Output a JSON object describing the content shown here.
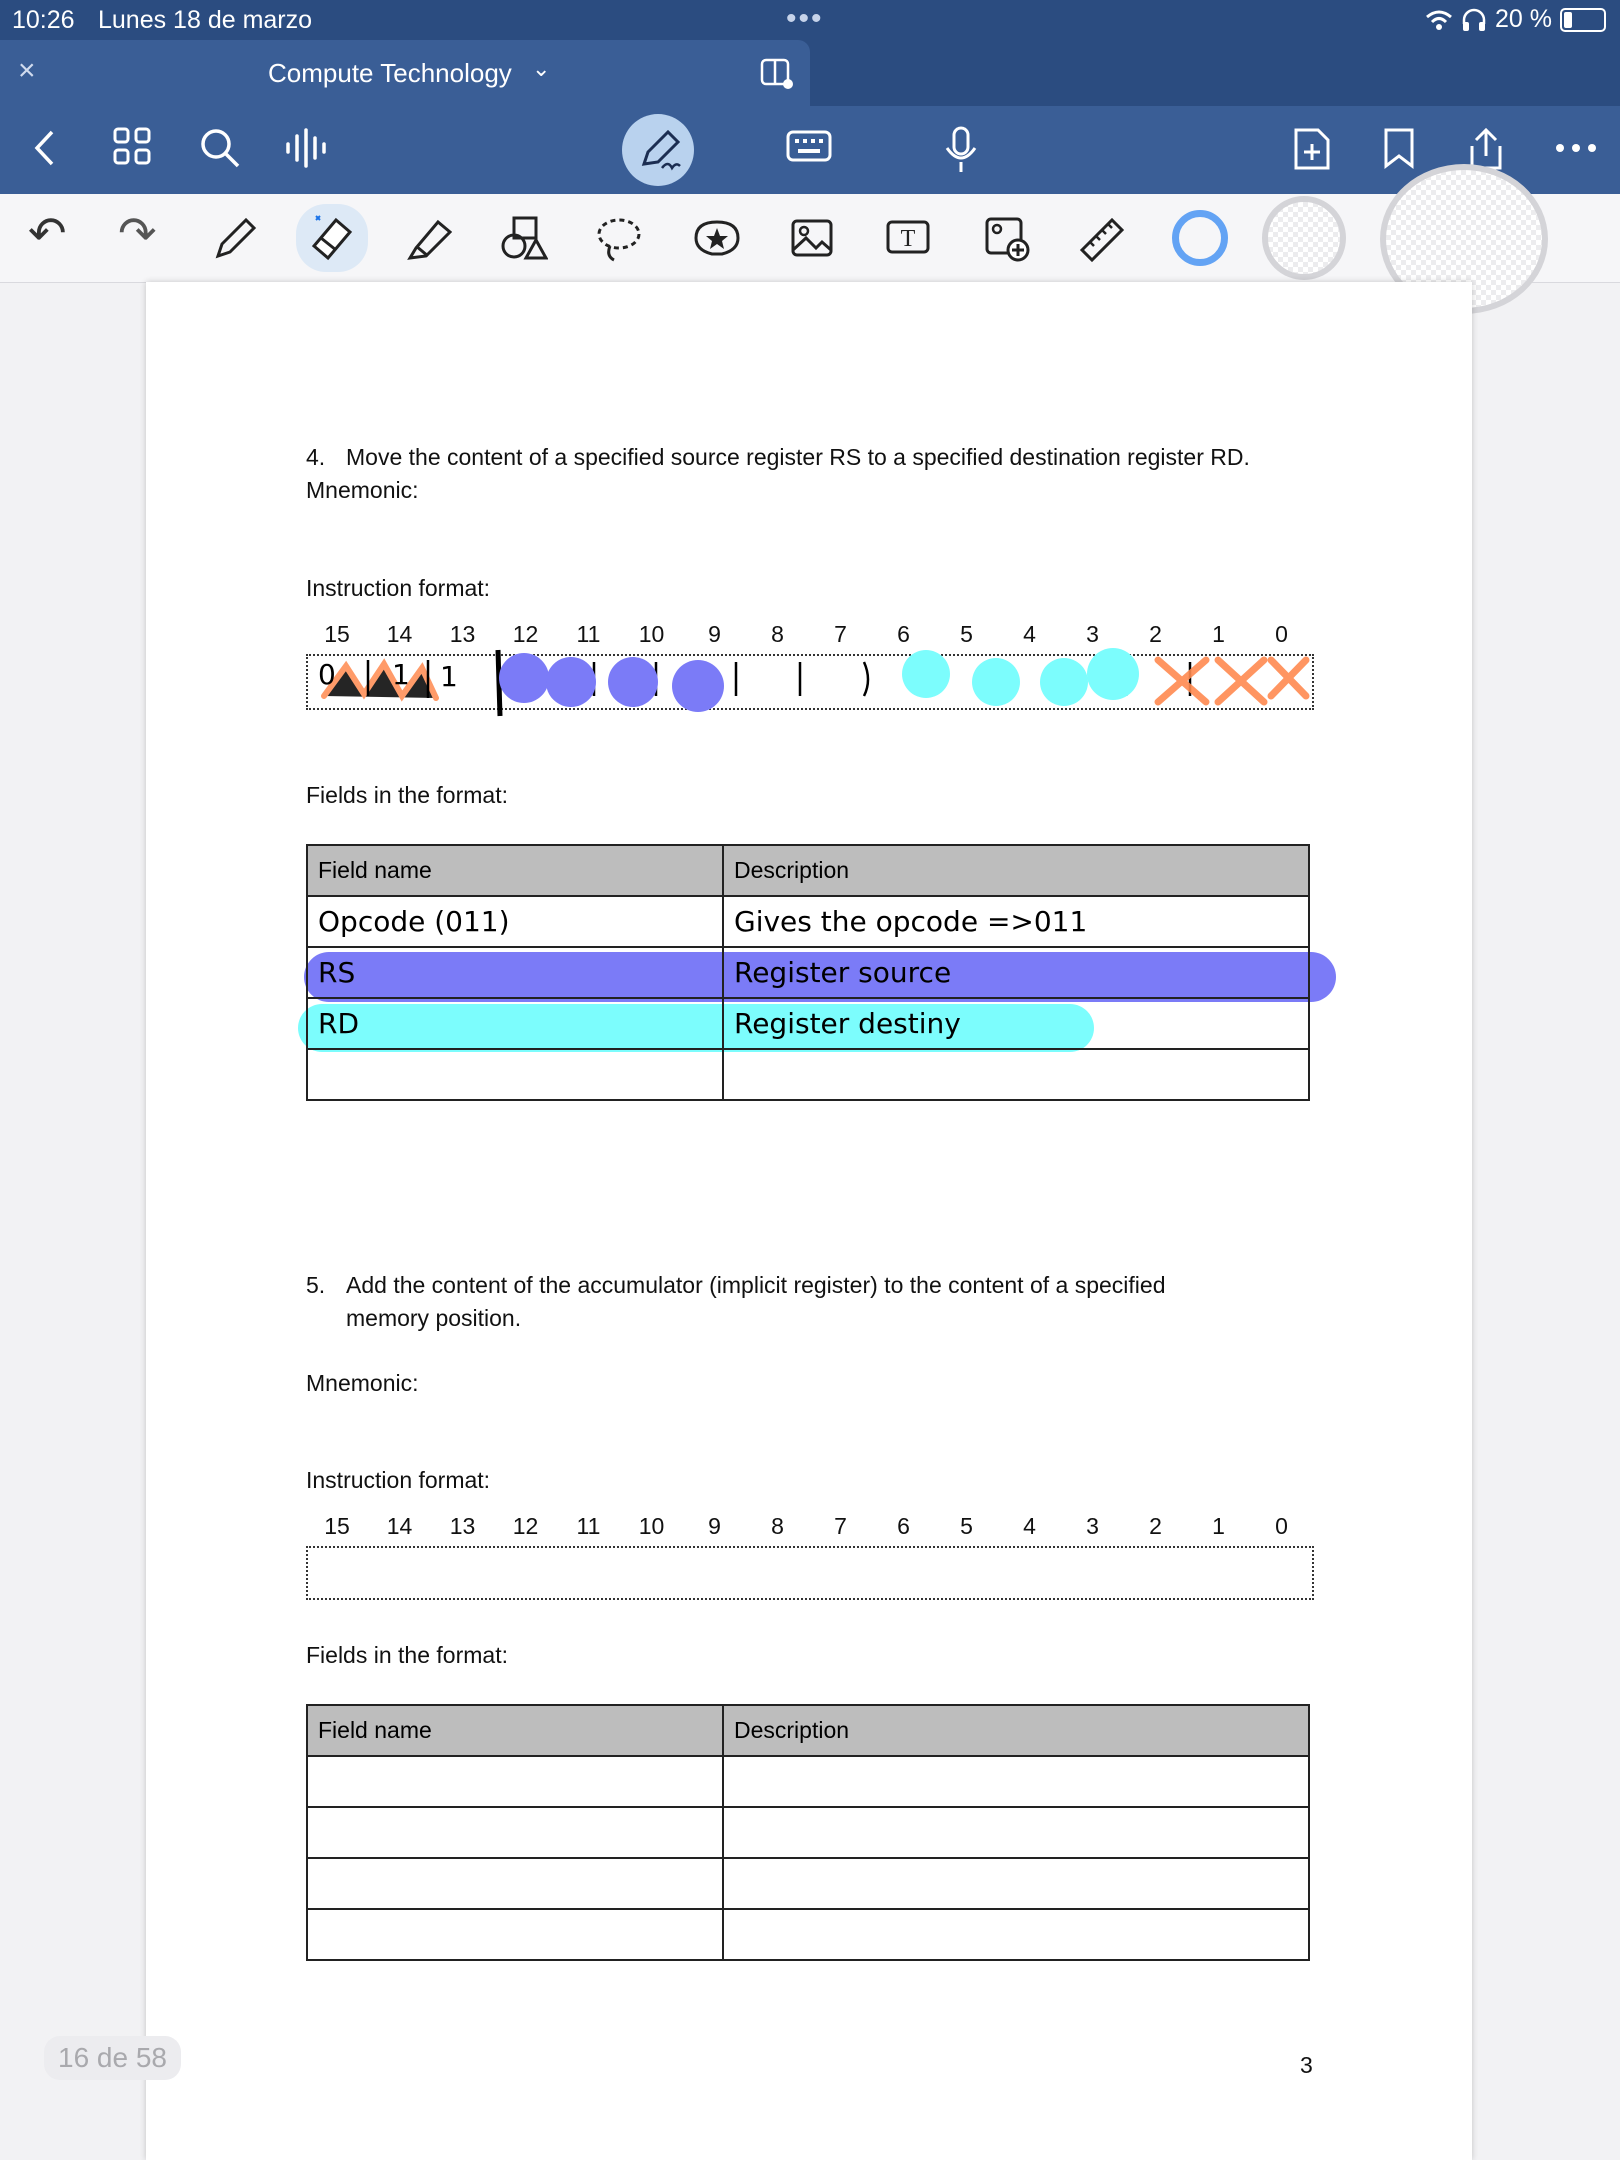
{
  "status_bar": {
    "time": "10:26",
    "date": "Lunes 18 de marzo",
    "dots": "•••",
    "battery": "20 %",
    "battery_level": 0.2
  },
  "tab": {
    "close_glyph": "×",
    "title": "Compute Technology",
    "chevron": "⌄"
  },
  "toolbar": {
    "undo": "↶",
    "redo": "↷"
  },
  "document": {
    "bit_positions": [
      "15",
      "14",
      "13",
      "12",
      "11",
      "10",
      "9",
      "8",
      "7",
      "6",
      "5",
      "4",
      "3",
      "2",
      "1",
      "0"
    ],
    "section4": {
      "title_number": "4.",
      "title_text": "Move the content of a specified source register RS to a specified destination register RD.",
      "mnemonic_label": "Mnemonic:",
      "instruction_format_label": "Instruction format:",
      "fields_label": "Fields in the format:",
      "table_header": [
        "Field name",
        "Description"
      ],
      "handwritten_bits": [
        "0",
        "1",
        "1"
      ],
      "handwritten_rows": [
        {
          "field": "Opcode (011)",
          "desc": "Gives the opcode =>011"
        },
        {
          "field": "RS",
          "desc": "Register source"
        },
        {
          "field": "RD",
          "desc": "Register destiny"
        }
      ]
    },
    "section5": {
      "title_number": "5.",
      "title_line1": "Add the content of the accumulator (implicit register) to the content of a specified",
      "title_line2": "memory position.",
      "mnemonic_label": "Mnemonic:",
      "instruction_format_label": "Instruction format:",
      "fields_label": "Fields in the format:",
      "table_header": [
        "Field name",
        "Description"
      ]
    },
    "page_number": "3"
  },
  "page_counter": "16 de 58",
  "colors": {
    "bar_blue": "#2b4c80",
    "highlight_purple": "#7b7bf7",
    "highlight_cyan": "#7cfdfd",
    "cross_orange": "#ff8a50"
  }
}
